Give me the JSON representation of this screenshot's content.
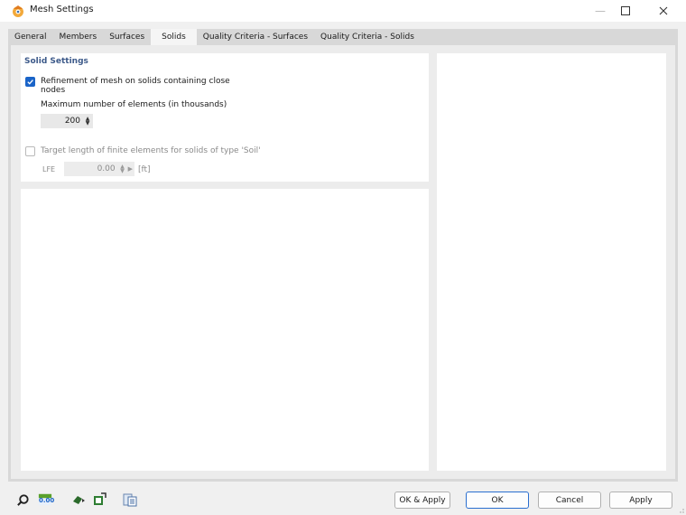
{
  "window": {
    "title": "Mesh Settings",
    "minimize_label": "—",
    "maximize_label": "☐",
    "close_label": "✕"
  },
  "tabs": [
    {
      "label": "General",
      "active": false
    },
    {
      "label": "Members",
      "active": false
    },
    {
      "label": "Surfaces",
      "active": false
    },
    {
      "label": "Solids",
      "active": true
    },
    {
      "label": "Quality Criteria - Surfaces",
      "active": false
    },
    {
      "label": "Quality Criteria - Solids",
      "active": false
    }
  ],
  "solid_settings": {
    "title": "Solid Settings",
    "refinement": {
      "checked": true,
      "label_line1": "Refinement of mesh on solids containing close",
      "label_line2": "nodes"
    },
    "max_elements": {
      "label": "Maximum number of elements (in thousands)",
      "value": "200"
    },
    "target_length": {
      "checked": false,
      "enabled": false,
      "label": "Target length of finite elements for solids of type 'Soil'",
      "symbol": "LFE",
      "value": "0.00",
      "unit": "[ft]"
    }
  },
  "bottom_toolbar": {
    "icons": [
      "search-icon",
      "units-icon",
      "model-icon",
      "options-icon",
      "table-icon"
    ],
    "units_icon_text": "0.00"
  },
  "buttons": {
    "ok_apply": "OK & Apply",
    "ok": "OK",
    "cancel": "Cancel",
    "apply": "Apply"
  },
  "colors": {
    "accent": "#1a64c8",
    "section_title": "#3d5a8a",
    "tab_bar": "#d8d8d8",
    "content_bg": "#ececec"
  }
}
